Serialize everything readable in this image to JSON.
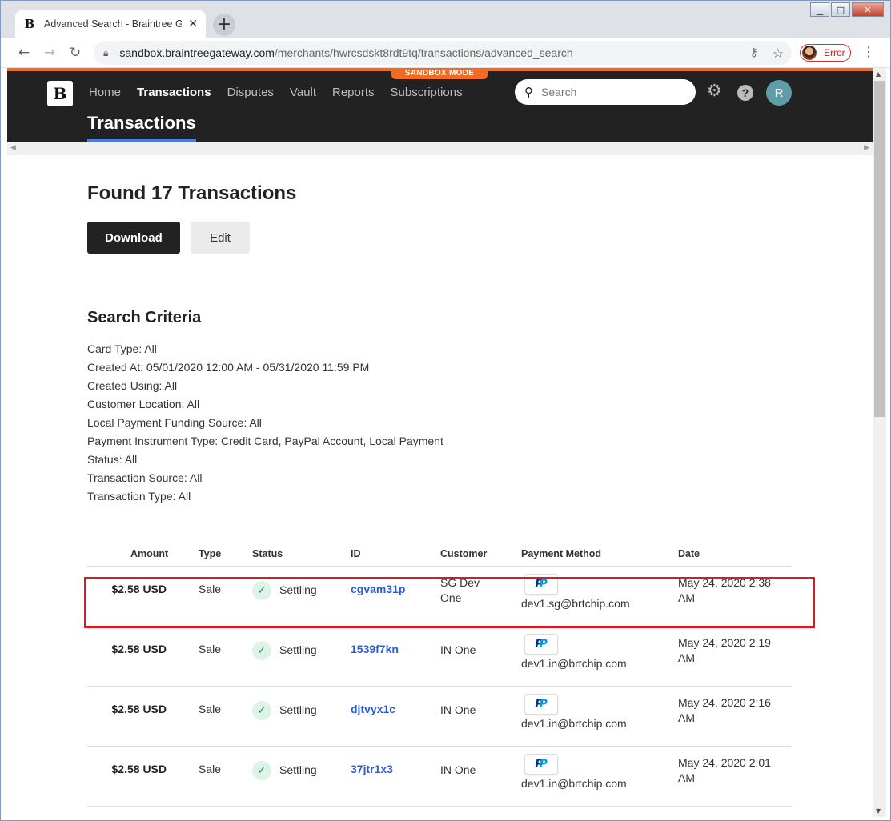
{
  "browser": {
    "tab_title": "Advanced Search - Braintree Gateway",
    "tab_favicon": "B",
    "url_host": "sandbox.braintreegateway.com",
    "url_path": "/merchants/hwrcsdskt8rdt9tq/transactions/advanced_search",
    "profile_status": "Error"
  },
  "app": {
    "sandbox_label": "SANDBOX MODE",
    "logo_letter": "B",
    "nav": [
      "Home",
      "Transactions",
      "Disputes",
      "Vault",
      "Reports",
      "Subscriptions"
    ],
    "active_nav": "Transactions",
    "search_placeholder": "Search",
    "avatar_initial": "R",
    "page_title": "Transactions",
    "accent_color": "#f26b21",
    "tab_underline_color": "#4a7ce8"
  },
  "results": {
    "heading": "Found 17 Transactions",
    "download_label": "Download",
    "edit_label": "Edit"
  },
  "criteria": {
    "title": "Search Criteria",
    "items": [
      "Card Type: All",
      "Created At: 05/01/2020 12:00 AM - 05/31/2020 11:59 PM",
      "Created Using: All",
      "Customer Location: All",
      "Local Payment Funding Source: All",
      "Payment Instrument Type: Credit Card, PayPal Account, Local Payment",
      "Status: All",
      "Transaction Source: All",
      "Transaction Type: All"
    ]
  },
  "table": {
    "headers": [
      "Amount",
      "Type",
      "Status",
      "ID",
      "Customer",
      "Payment Method",
      "Date"
    ],
    "rows": [
      {
        "amount": "$2.58 USD",
        "type": "Sale",
        "status": "Settling",
        "id": "cgvam31p",
        "customer": "SG Dev One",
        "payment_icon": "paypal-icon",
        "email": "dev1.sg@brtchip.com",
        "date": "May 24, 2020 2:38 AM"
      },
      {
        "amount": "$2.58 USD",
        "type": "Sale",
        "status": "Settling",
        "id": "1539f7kn",
        "customer": "IN One",
        "payment_icon": "paypal-icon",
        "email": "dev1.in@brtchip.com",
        "date": "May 24, 2020 2:19 AM"
      },
      {
        "amount": "$2.58 USD",
        "type": "Sale",
        "status": "Settling",
        "id": "djtvyx1c",
        "customer": "IN One",
        "payment_icon": "paypal-icon",
        "email": "dev1.in@brtchip.com",
        "date": "May 24, 2020 2:16 AM"
      },
      {
        "amount": "$2.58 USD",
        "type": "Sale",
        "status": "Settling",
        "id": "37jtr1x3",
        "customer": "IN One",
        "payment_icon": "paypal-icon",
        "email": "dev1.in@brtchip.com",
        "date": "May 24, 2020 2:01 AM"
      }
    ],
    "highlight_color": "#e3151e"
  }
}
